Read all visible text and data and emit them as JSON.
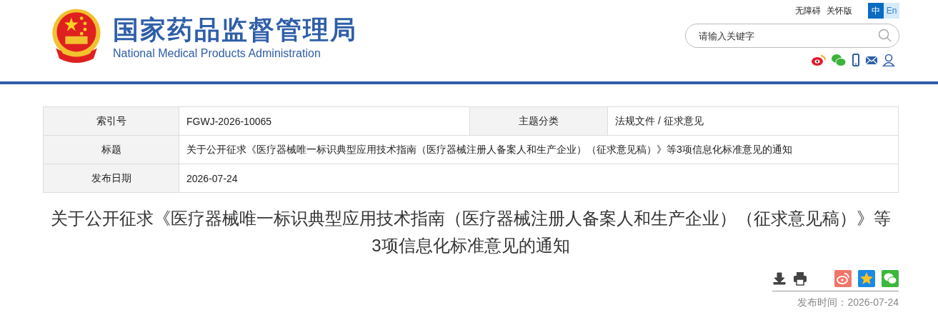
{
  "header": {
    "title": "国家药品监督管理局",
    "subtitle": "National Medical Products Administration",
    "links": [
      "无障碍",
      "关怀版"
    ],
    "languages": [
      {
        "label": "中",
        "selected": true
      },
      {
        "label": "En",
        "selected": false
      }
    ],
    "search": {
      "placeholder": "请输入关键字"
    }
  },
  "info_table": {
    "rows": [
      {
        "cells": [
          {
            "label": "索引号",
            "value": "FGWJ-2026-10065"
          },
          {
            "label": "主题分类",
            "value": "法规文件 / 征求意见"
          }
        ]
      },
      {
        "cells": [
          {
            "label": "标题",
            "value": "关于公开征求《医疗器械唯一标识典型应用技术指南（医疗器械注册人备案人和生产企业）（征求意见稿）》等3项信息化标准意见的通知"
          }
        ]
      },
      {
        "cells": [
          {
            "label": "发布日期",
            "value": "2026-07-24"
          }
        ]
      }
    ]
  },
  "article": {
    "title": "关于公开征求《医疗器械唯一标识典型应用技术指南（医疗器械注册人备案人和生产企业）（征求意见稿）》等3项信息化标准意见的通知",
    "publish_time": "发布时间：2026-07-24"
  }
}
